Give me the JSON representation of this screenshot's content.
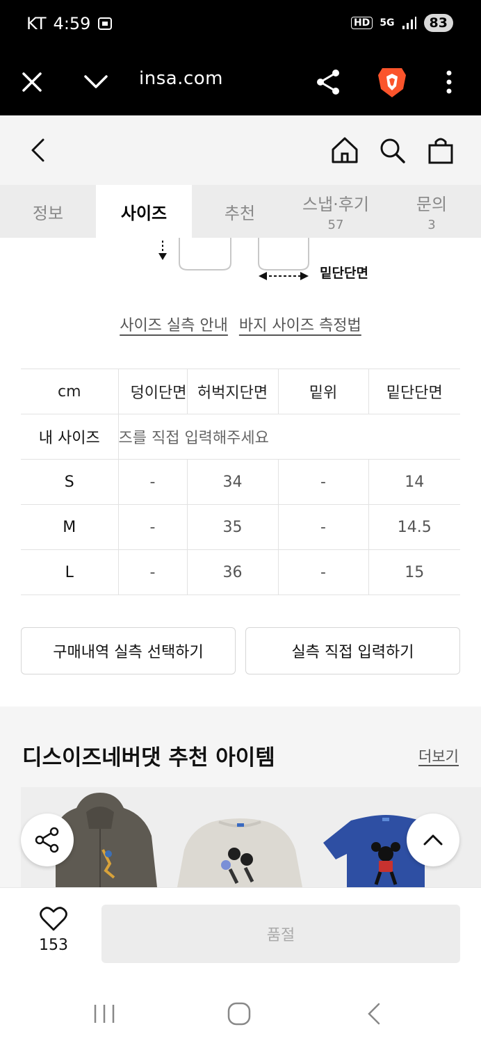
{
  "status_bar": {
    "carrier": "KT",
    "time": "4:59",
    "battery": "83",
    "network": "5G",
    "hd": "HD"
  },
  "browser": {
    "url": "insa.com"
  },
  "tabs": [
    {
      "label": "정보",
      "count": ""
    },
    {
      "label": "사이즈",
      "count": ""
    },
    {
      "label": "추천",
      "count": ""
    },
    {
      "label": "스냅·후기",
      "count": "57"
    },
    {
      "label": "문의",
      "count": "3"
    }
  ],
  "diagram": {
    "label": "밑단단면"
  },
  "links": {
    "size_guide": "사이즈 실측 안내",
    "pants_method": "바지 사이즈 측정법"
  },
  "size_table": {
    "headers": [
      "cm",
      "덩이단면",
      "허벅지단면",
      "밑위",
      "밑단단면"
    ],
    "my_size_label": "내 사이즈",
    "my_size_placeholder": "즈를 직접 입력해주세요",
    "rows": [
      [
        "S",
        "-",
        "34",
        "-",
        "14"
      ],
      [
        "M",
        "-",
        "35",
        "-",
        "14.5"
      ],
      [
        "L",
        "-",
        "36",
        "-",
        "15"
      ]
    ]
  },
  "buttons": {
    "purchase_history": "구매내역 실측 선택하기",
    "direct_input": "실측 직접 입력하기"
  },
  "recommend": {
    "title": "디스이즈네버댓 추천 아이템",
    "more": "더보기"
  },
  "bottom": {
    "like_count": "153",
    "soldout": "품절"
  },
  "colors": {
    "accent_brave": "#fb542b",
    "tab_bg": "#ececec",
    "header_bg": "#f4f4f4"
  }
}
